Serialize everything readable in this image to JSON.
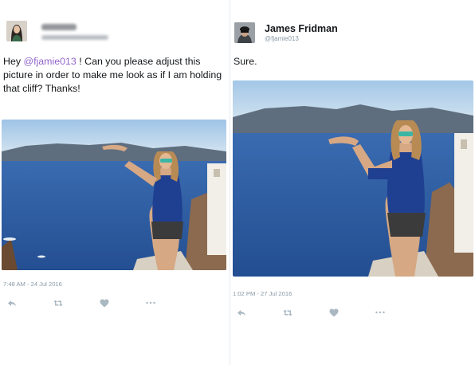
{
  "left_tweet": {
    "text_parts": {
      "prefix": "Hey ",
      "mention": "@fjamie013",
      "body": " ! Can you please adjust this picture in order to make me look as if I am holding that cliff? Thanks!"
    },
    "timestamp": "7:48 AM - 24 Jul 2016",
    "photo_description_icon": "photo"
  },
  "right_tweet": {
    "display_name": "James Fridman",
    "handle": "@fjamie013",
    "text": "Sure.",
    "timestamp": "1:02 PM - 27 Jul 2016",
    "photo_description_icon": "photo"
  },
  "actions": {
    "reply_icon": "reply-icon",
    "retweet_icon": "retweet-icon",
    "like_icon": "heart-icon",
    "more_icon": "more-icon"
  },
  "colors": {
    "link": "#9266cc",
    "muted": "#8899a6",
    "icon": "#aab8c2",
    "sea": "#2e5c9e",
    "sky": "#a9cbe8",
    "shirt": "#1f3f91"
  }
}
